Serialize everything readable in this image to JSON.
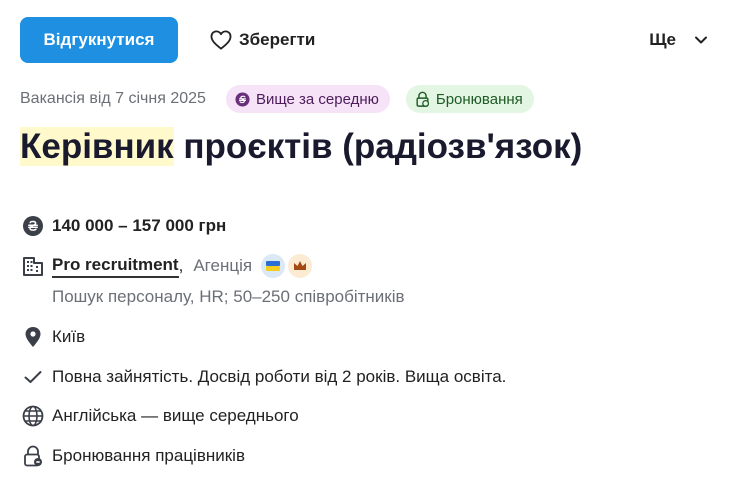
{
  "actions": {
    "apply_label": "Відгукнутися",
    "save_label": "Зберегти",
    "more_label": "Ще"
  },
  "meta": {
    "posted": "Вакансія від 7 січня 2025",
    "badges": [
      {
        "label": "Вище за середню",
        "icon": "coin-icon",
        "color": "#f6e3f7"
      },
      {
        "label": "Бронювання",
        "icon": "lock-badge-icon",
        "color": "#e3f5e3"
      }
    ]
  },
  "job": {
    "title_highlight": "Керівник",
    "title_rest": " проєктів (радіозв'язок)"
  },
  "details": {
    "salary": "140 000 – 157 000 грн",
    "company_name": "Pro recruitment",
    "company_type": "Агенція",
    "company_description": "Пошук персоналу, HR; 50–250 співробітників",
    "location": "Київ",
    "requirements": "Повна зайнятість. Досвід роботи від 2 років. Вища освіта.",
    "language": "Англійська — вище середнього",
    "reservation": "Бронювання працівників"
  },
  "colors": {
    "primary": "#1e8fe1",
    "title_highlight": "#fff9cc"
  }
}
